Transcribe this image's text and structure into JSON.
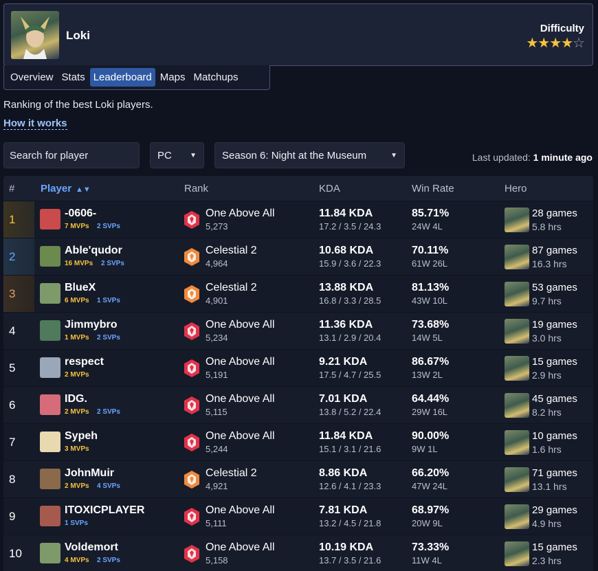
{
  "hero": {
    "name": "Loki",
    "difficulty_label": "Difficulty",
    "difficulty_stars": 4,
    "difficulty_max": 5
  },
  "tabs": [
    {
      "label": "Overview"
    },
    {
      "label": "Stats"
    },
    {
      "label": "Leaderboard",
      "active": true
    },
    {
      "label": "Maps"
    },
    {
      "label": "Matchups"
    }
  ],
  "intro": "Ranking of the best Loki players.",
  "how_it_works": "How it works",
  "search": {
    "placeholder": "Search for player"
  },
  "filters": {
    "platform": "PC",
    "season": "Season 6: Night at the Museum"
  },
  "updated": {
    "label": "Last updated:",
    "value": "1 minute ago"
  },
  "columns": {
    "rank_num": "#",
    "player": "Player",
    "rank": "Rank",
    "kda": "KDA",
    "winrate": "Win Rate",
    "hero": "Hero"
  },
  "rows": [
    {
      "n": "1",
      "name": "-0606-",
      "mvps": "7 MVPs",
      "svps": "2 SVPs",
      "rank": "One Above All",
      "score": "5,273",
      "kda": "11.84 KDA",
      "kda_line": "17.2 / 3.5 / 24.3",
      "wr": "85.71%",
      "wl": "24W 4L",
      "games": "28 games",
      "hrs": "5.8 hrs",
      "avatar_color": "#c94b4b",
      "rank_color": "#e0344a"
    },
    {
      "n": "2",
      "name": "Able'qudor",
      "mvps": "16 MVPs",
      "svps": "2 SVPs",
      "rank": "Celestial 2",
      "score": "4,964",
      "kda": "10.68 KDA",
      "kda_line": "15.9 / 3.6 / 22.3",
      "wr": "70.11%",
      "wl": "61W 26L",
      "games": "87 games",
      "hrs": "16.3 hrs",
      "avatar_color": "#6b8a4e",
      "rank_color": "#f08a3c"
    },
    {
      "n": "3",
      "name": "BlueX",
      "mvps": "6 MVPs",
      "svps": "1 SVPs",
      "rank": "Celestial 2",
      "score": "4,901",
      "kda": "13.88 KDA",
      "kda_line": "16.8 / 3.3 / 28.5",
      "wr": "81.13%",
      "wl": "43W 10L",
      "games": "53 games",
      "hrs": "9.7 hrs",
      "avatar_color": "#7f9a6a",
      "rank_color": "#f08a3c"
    },
    {
      "n": "4",
      "name": "Jimmybro",
      "mvps": "1 MVPs",
      "svps": "2 SVPs",
      "rank": "One Above All",
      "score": "5,234",
      "kda": "11.36 KDA",
      "kda_line": "13.1 / 2.9 / 20.4",
      "wr": "73.68%",
      "wl": "14W 5L",
      "games": "19 games",
      "hrs": "3.0 hrs",
      "avatar_color": "#4f7a5c",
      "rank_color": "#e0344a"
    },
    {
      "n": "5",
      "name": "respect",
      "mvps": "2 MVPs",
      "svps": "",
      "rank": "One Above All",
      "score": "5,191",
      "kda": "9.21 KDA",
      "kda_line": "17.5 / 4.7 / 25.5",
      "wr": "86.67%",
      "wl": "13W 2L",
      "games": "15 games",
      "hrs": "2.9 hrs",
      "avatar_color": "#9aa7b8",
      "rank_color": "#e0344a"
    },
    {
      "n": "6",
      "name": "IDG.",
      "mvps": "2 MVPs",
      "svps": "2 SVPs",
      "rank": "One Above All",
      "score": "5,115",
      "kda": "7.01 KDA",
      "kda_line": "13.8 / 5.2 / 22.4",
      "wr": "64.44%",
      "wl": "29W 16L",
      "games": "45 games",
      "hrs": "8.2 hrs",
      "avatar_color": "#d66c7a",
      "rank_color": "#e0344a"
    },
    {
      "n": "7",
      "name": "Sypeh",
      "mvps": "3 MVPs",
      "svps": "",
      "rank": "One Above All",
      "score": "5,244",
      "kda": "11.84 KDA",
      "kda_line": "15.1 / 3.1 / 21.6",
      "wr": "90.00%",
      "wl": "9W 1L",
      "games": "10 games",
      "hrs": "1.6 hrs",
      "avatar_color": "#e8d9b0",
      "rank_color": "#e0344a"
    },
    {
      "n": "8",
      "name": "JohnMuir",
      "mvps": "2 MVPs",
      "svps": "4 SVPs",
      "rank": "Celestial 2",
      "score": "4,921",
      "kda": "8.86 KDA",
      "kda_line": "12.6 / 4.1 / 23.3",
      "wr": "66.20%",
      "wl": "47W 24L",
      "games": "71 games",
      "hrs": "13.1 hrs",
      "avatar_color": "#8a6a4a",
      "rank_color": "#f08a3c"
    },
    {
      "n": "9",
      "name": "ITOXICPLAYER",
      "mvps": "",
      "svps": "1 SVPs",
      "rank": "One Above All",
      "score": "5,111",
      "kda": "7.81 KDA",
      "kda_line": "13.2 / 4.5 / 21.8",
      "wr": "68.97%",
      "wl": "20W 9L",
      "games": "29 games",
      "hrs": "4.9 hrs",
      "avatar_color": "#a65a4e",
      "rank_color": "#e0344a"
    },
    {
      "n": "10",
      "name": "Voldemort",
      "mvps": "4 MVPs",
      "svps": "2 SVPs",
      "rank": "One Above All",
      "score": "5,158",
      "kda": "10.19 KDA",
      "kda_line": "13.7 / 3.5 / 21.6",
      "wr": "73.33%",
      "wl": "11W 4L",
      "games": "15 games",
      "hrs": "2.3 hrs",
      "avatar_color": "#7f9a6a",
      "rank_color": "#e0344a"
    }
  ]
}
